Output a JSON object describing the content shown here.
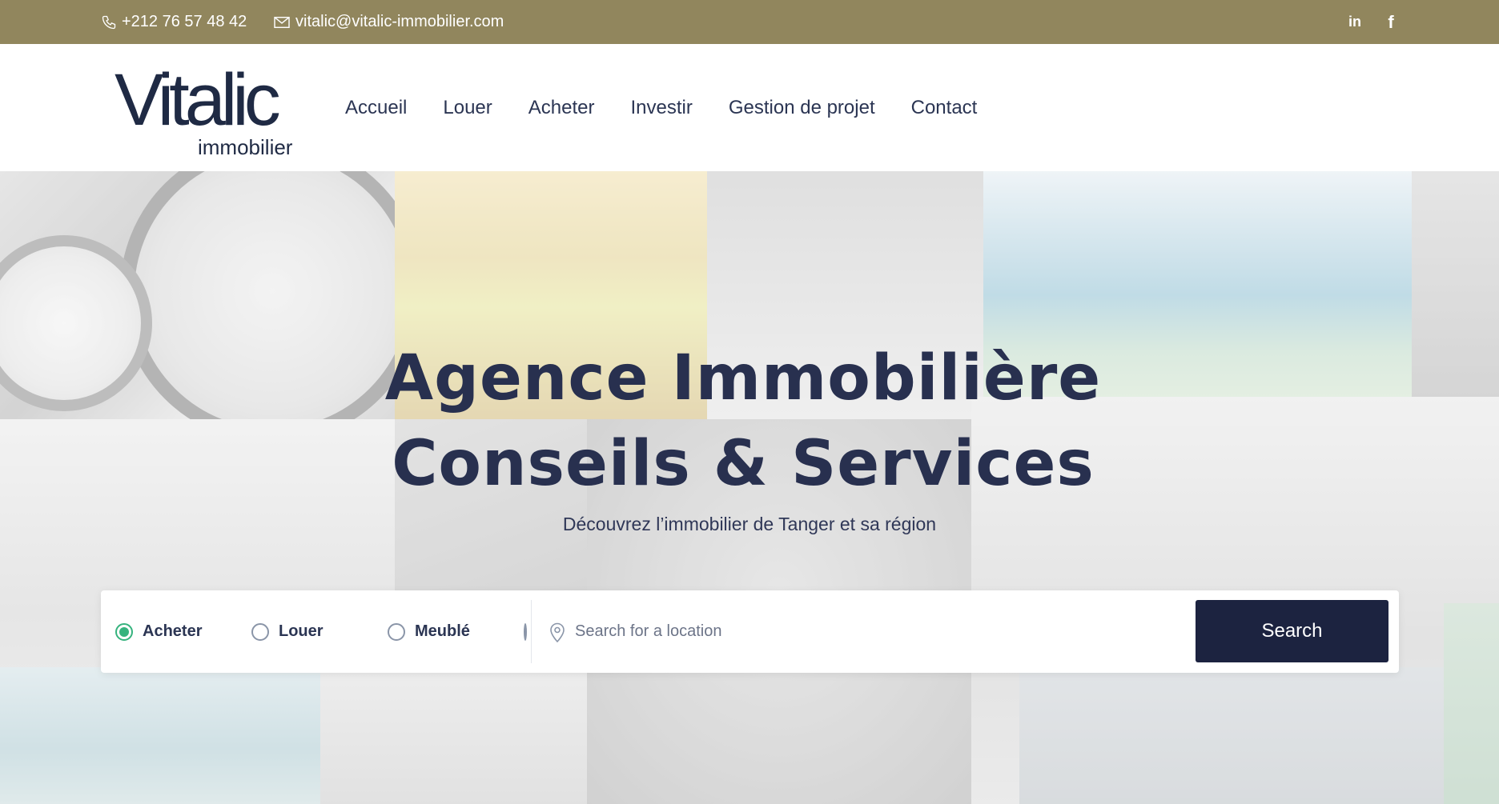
{
  "topbar": {
    "phone": "+212 76 57 48 42",
    "email": "vitalic@vitalic-immobilier.com",
    "social": [
      {
        "icon": "linkedin-icon",
        "glyph": "in"
      },
      {
        "icon": "facebook-icon",
        "glyph": "f"
      }
    ],
    "background": "#91865d"
  },
  "header": {
    "logo": {
      "brand": "Vitalic",
      "tagline": "immobilier"
    },
    "nav": [
      "Accueil",
      "Louer",
      "Acheter",
      "Investir",
      "Gestion de projet",
      "Contact"
    ]
  },
  "hero": {
    "title_line1": "Agence Immobilière",
    "title_line2": "Conseils & Services",
    "subtitle": "Découvrez l’immobilier de Tanger et sa région"
  },
  "search": {
    "options": [
      {
        "label": "Acheter",
        "checked": true
      },
      {
        "label": "Louer",
        "checked": false
      },
      {
        "label": "Meublé",
        "checked": false
      }
    ],
    "location_placeholder": "Search for a location",
    "button_label": "Search",
    "button_color": "#1c2340",
    "accent": "#36b37e"
  }
}
